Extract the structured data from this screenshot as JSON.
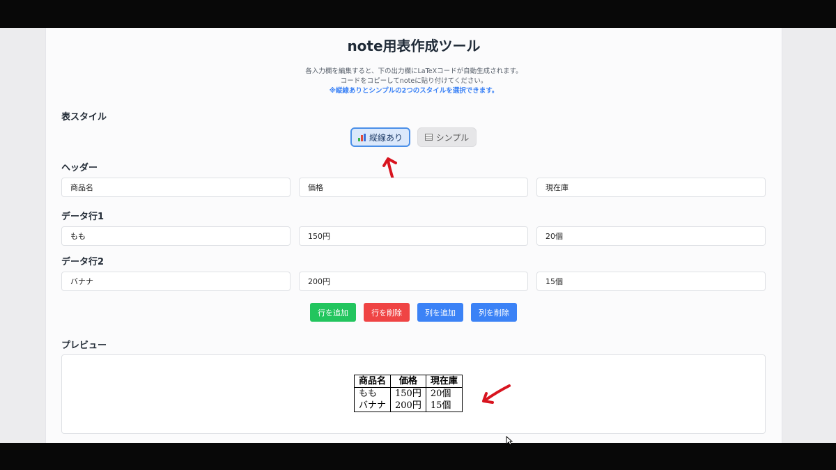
{
  "app": {
    "title": "note用表作成ツール",
    "description_lines": [
      "各入力欄を編集すると、下の出力欄にLaTeXコードが自動生成されます。",
      "コードをコピーしてnoteに貼り付けてください。",
      "※縦線ありとシンプルの2つのスタイルを選択できます。"
    ]
  },
  "style_section": {
    "label": "表スタイル",
    "options": [
      {
        "label": "縦線あり",
        "icon": "bar-chart-icon",
        "selected": true
      },
      {
        "label": "シンプル",
        "icon": "grid-table-icon",
        "selected": false
      }
    ]
  },
  "header_section": {
    "label": "ヘッダー",
    "cells": [
      "商品名",
      "価格",
      "現在庫"
    ]
  },
  "rows": [
    {
      "label": "データ行1",
      "cells": [
        "もも",
        "150円",
        "20個"
      ]
    },
    {
      "label": "データ行2",
      "cells": [
        "バナナ",
        "200円",
        "15個"
      ]
    }
  ],
  "actions": [
    {
      "label": "行を追加",
      "color": "#22c55e"
    },
    {
      "label": "行を削除",
      "color": "#ef4444"
    },
    {
      "label": "列を追加",
      "color": "#3b82f6"
    },
    {
      "label": "列を削除",
      "color": "#3b82f6"
    }
  ],
  "preview": {
    "label": "プレビュー",
    "table": {
      "header": [
        "商品名",
        "価格",
        "現在庫"
      ],
      "rows": [
        [
          "もも",
          "150円",
          "20個"
        ],
        [
          "バナナ",
          "200円",
          "15個"
        ]
      ]
    }
  },
  "colors": {
    "annotation_arrow": "#d8141f",
    "accent": "#4a8fe8"
  }
}
